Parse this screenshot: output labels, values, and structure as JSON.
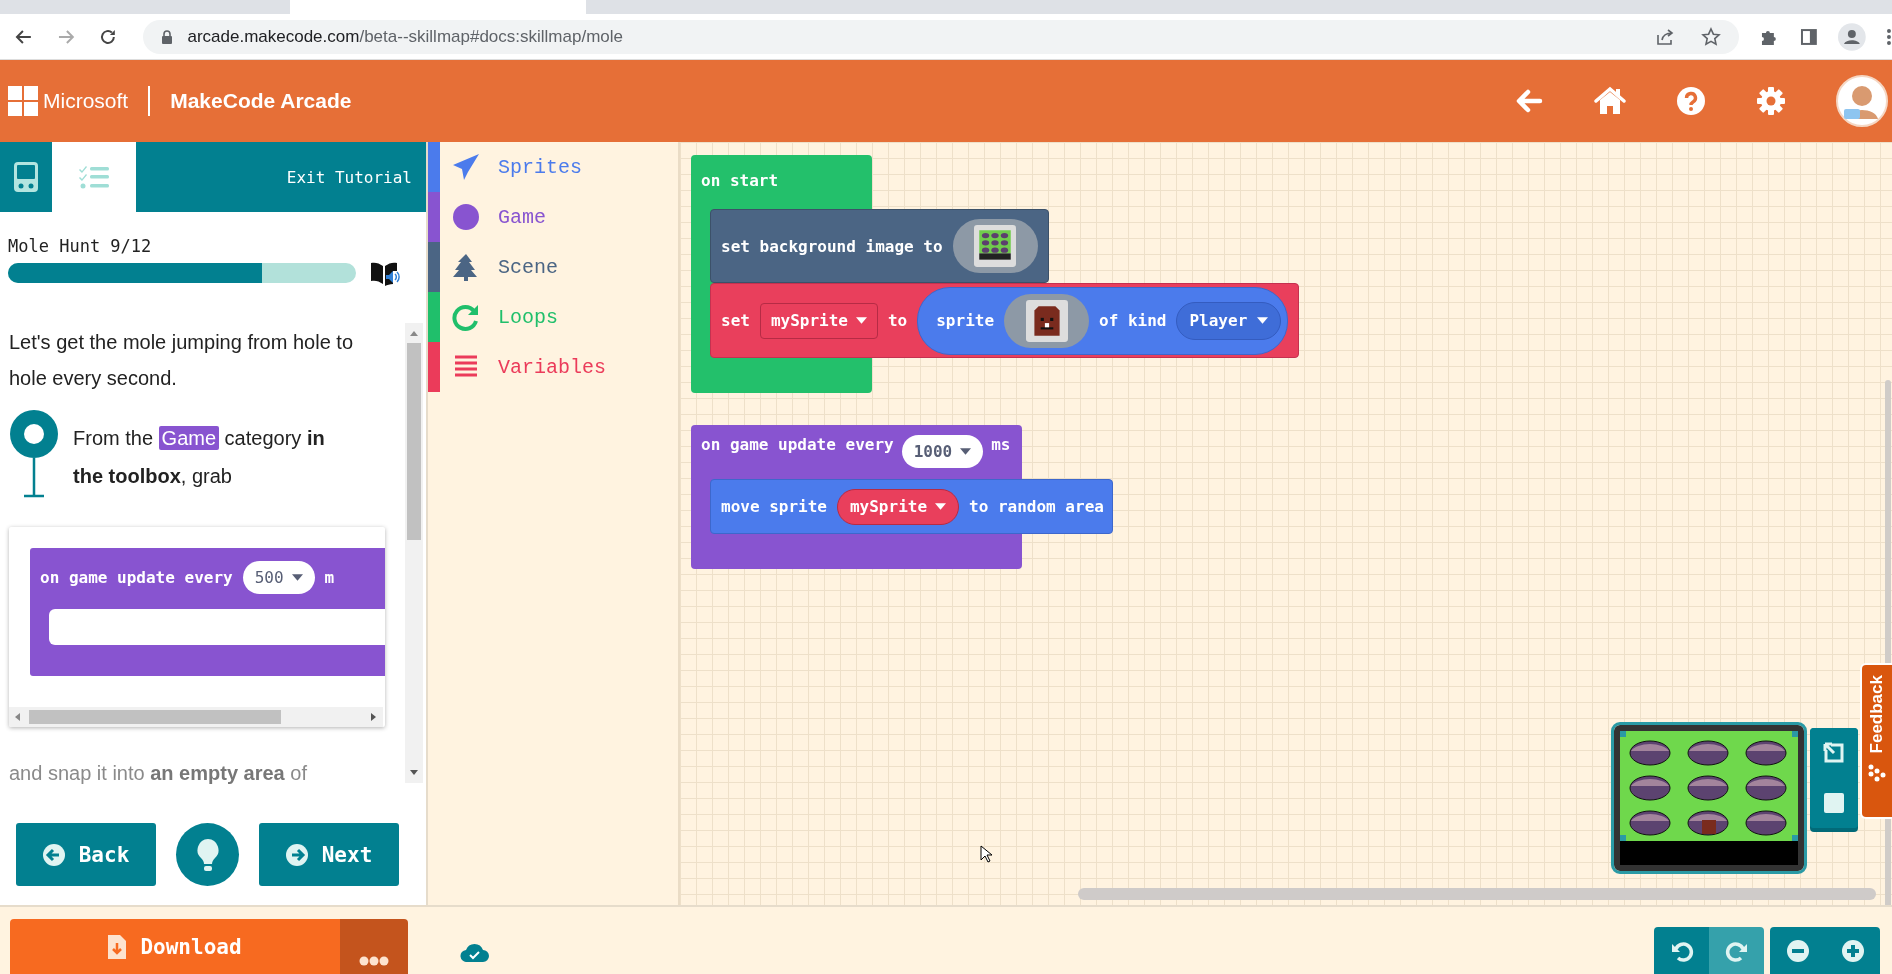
{
  "browser": {
    "url_host": "arcade.makecode.com",
    "url_path": "/beta--skillmap#docs:skillmap/mole"
  },
  "header": {
    "brand": "Microsoft",
    "product": "MakeCode Arcade"
  },
  "tutorial": {
    "tabs": [
      {
        "kind": "simulator",
        "selected": false
      },
      {
        "kind": "steps",
        "selected": true
      }
    ],
    "exit": "Exit Tutorial",
    "title": "Mole Hunt 9/12",
    "progress": {
      "level": 0.73
    },
    "intro": "Let's get the mole jumping from hole to hole every second.",
    "step": {
      "before": "From the",
      "category": "Game",
      "after": "category **in the toolbox**, grab"
    },
    "example": {
      "label": "on game update every",
      "interval": "500",
      "unit": "m"
    },
    "faded": "and snap it into **an empty area** of",
    "back": "Back",
    "next": "Next"
  },
  "toolbox": [
    {
      "name": "Sprites",
      "kind": "sprites",
      "color": "#4b7bec"
    },
    {
      "name": "Game",
      "kind": "game",
      "color": "#8854d0"
    },
    {
      "name": "Scene",
      "kind": "scene",
      "color": "#4b6584"
    },
    {
      "name": "Loops",
      "kind": "loops",
      "color": "#20bf6b"
    },
    {
      "name": "Variables",
      "kind": "variables",
      "color": "#eb3b5a"
    }
  ],
  "workspace": {
    "on_start": {
      "label": "on start",
      "set_background": {
        "label": "set background image to"
      },
      "set_sprite": {
        "set": "set",
        "variable": "mySprite",
        "to": "to",
        "sprite": "sprite",
        "of_kind": "of kind",
        "kind_value": "Player"
      }
    },
    "game_update": {
      "label": "on game update every",
      "interval": "1000",
      "unit": "ms",
      "move": {
        "label": "move sprite",
        "variable": "mySprite",
        "rest": "to random area"
      }
    }
  },
  "feedback": "Feedback",
  "download": "Download"
}
